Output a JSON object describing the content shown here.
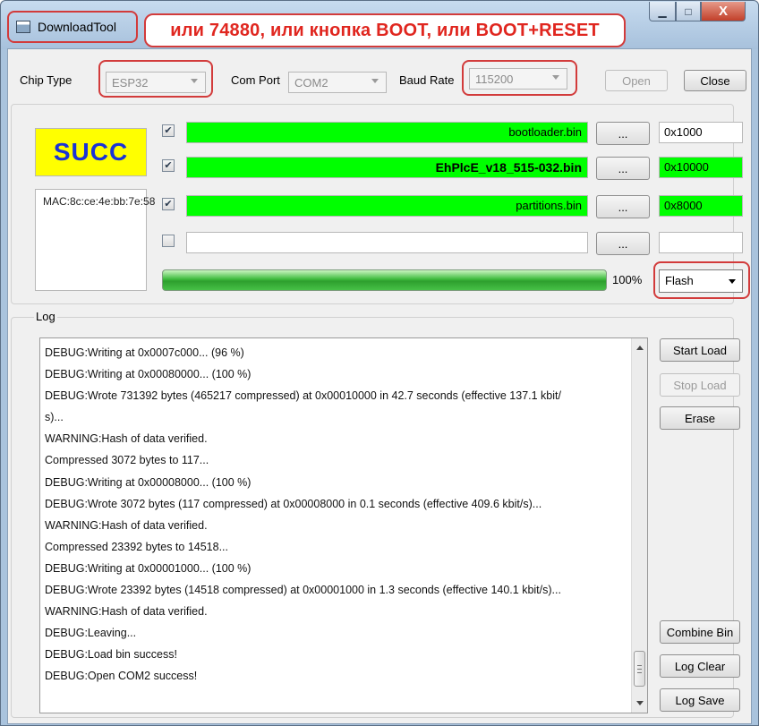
{
  "window": {
    "title": "DownloadTool",
    "annotation": "или 74880, или кнопка BOOT, или BOOT+RESET",
    "minimize_glyph": "▁",
    "maximize_glyph": "□",
    "close_glyph": "X"
  },
  "settings": {
    "chip_type_label": "Chip Type",
    "chip_type_value": "ESP32",
    "com_port_label": "Com Port",
    "com_port_value": "COM2",
    "baud_rate_label": "Baud Rate",
    "baud_rate_value": "115200",
    "open_label": "Open",
    "close_label": "Close"
  },
  "status": {
    "result": "SUCC",
    "mac": "MAC:8c:ce:4e:bb:7e:58",
    "result_bg": "#ffff00",
    "result_color": "#1a33d6"
  },
  "files": [
    {
      "checked": true,
      "name": "bootloader.bin",
      "address": "0x1000",
      "browse": "...",
      "bar_green": true,
      "addr_green": false
    },
    {
      "checked": true,
      "name": "EhPlcE_v18_515-032.bin",
      "address": "0x10000",
      "browse": "...",
      "bar_green": true,
      "addr_green": true
    },
    {
      "checked": true,
      "name": "partitions.bin",
      "address": "0x8000",
      "browse": "...",
      "bar_green": true,
      "addr_green": true
    },
    {
      "checked": false,
      "name": "",
      "address": "",
      "browse": "...",
      "bar_green": false,
      "addr_green": false
    }
  ],
  "progress": {
    "percent": 100,
    "text": "100%",
    "mode_value": "Flash"
  },
  "log": {
    "title": "Log",
    "lines": [
      "DEBUG:Writing at 0x0007c000... (96 %)",
      "DEBUG:Writing at 0x00080000... (100 %)",
      "DEBUG:Wrote 731392 bytes (465217 compressed) at 0x00010000 in 42.7 seconds (effective 137.1 kbit/",
      "s)...",
      "WARNING:Hash of data verified.",
      "Compressed 3072 bytes to 117...",
      "DEBUG:Writing at 0x00008000... (100 %)",
      "DEBUG:Wrote 3072 bytes (117 compressed) at 0x00008000 in 0.1 seconds (effective 409.6 kbit/s)...",
      "WARNING:Hash of data verified.",
      "Compressed 23392 bytes to 14518...",
      "DEBUG:Writing at 0x00001000... (100 %)",
      "DEBUG:Wrote 23392 bytes (14518 compressed) at 0x00001000 in 1.3 seconds (effective 140.1 kbit/s)...",
      "WARNING:Hash of data verified.",
      "DEBUG:Leaving...",
      "DEBUG:Load bin success!",
      "DEBUG:Open COM2 success!"
    ]
  },
  "actions": {
    "start_load": "Start Load",
    "stop_load": "Stop Load",
    "erase": "Erase",
    "combine_bin": "Combine Bin",
    "log_clear": "Log Clear",
    "log_save": "Log Save"
  },
  "colors": {
    "success_green": "#00ff00",
    "annotation_red": "#d23b3b"
  }
}
